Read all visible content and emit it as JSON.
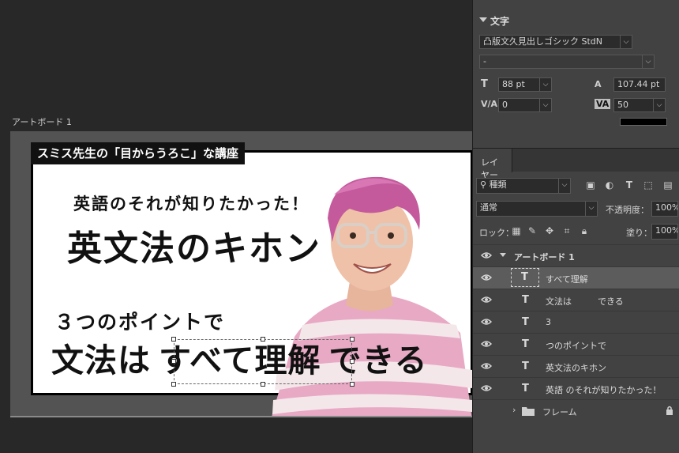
{
  "artboard": {
    "label": "アートボード 1"
  },
  "design": {
    "banner": "スミス先生の「目からうろこ」な講座",
    "sub_heading": "英語のそれが知りたかった！",
    "main_title": "英文法のキホン",
    "points_line": "３つのポイントで",
    "big_line_left": "文法は",
    "big_line_selected": "すべて理解",
    "big_line_right": "できる"
  },
  "character_panel": {
    "title": "文字",
    "font_family": "凸版文久見出しゴシック StdN",
    "font_style": "-",
    "font_size": "88 pt",
    "leading": "107.44 pt",
    "kerning": "0",
    "tracking": "50",
    "color": "#000000"
  },
  "layers_panel": {
    "tab_label": "レイヤー",
    "filter_kind": "種類",
    "blend_mode": "通常",
    "opacity_label": "不透明度：",
    "opacity_value": "100%",
    "lock_label": "ロック：",
    "fill_label": "塗り：",
    "fill_value": "100%",
    "layers": [
      {
        "name": "アートボード 1",
        "type": "artboard"
      },
      {
        "name": "すべて理解",
        "type": "text",
        "selected": true
      },
      {
        "name": "文法は　　　できる",
        "type": "text"
      },
      {
        "name": "3",
        "type": "text"
      },
      {
        "name": "つのポイントで",
        "type": "text"
      },
      {
        "name": "英文法のキホン",
        "type": "text"
      },
      {
        "name": "英語 のそれが知りたかった！",
        "type": "text"
      },
      {
        "name": "フレーム",
        "type": "folder"
      }
    ]
  },
  "icons": {
    "visibility": "eye-icon",
    "text_layer": "text-layer-icon",
    "folder": "folder-icon",
    "lock": "lock-icon"
  }
}
